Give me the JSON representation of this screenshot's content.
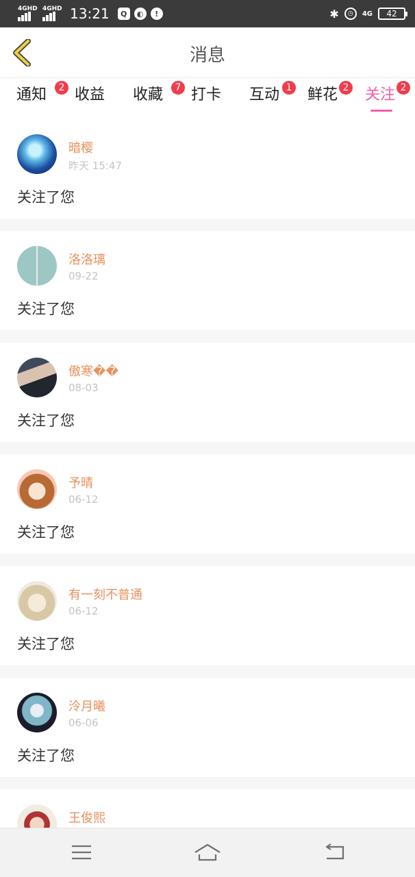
{
  "status_bar": {
    "net1": "4GHD",
    "net2": "4GHD",
    "time": "13:21",
    "net3": "4G",
    "battery": "42"
  },
  "header": {
    "title": "消息"
  },
  "tabs": [
    {
      "label": "通知",
      "badge": "2"
    },
    {
      "label": "收益",
      "badge": ""
    },
    {
      "label": "收藏",
      "badge": "7"
    },
    {
      "label": "打卡",
      "badge": ""
    },
    {
      "label": "互动",
      "badge": "1"
    },
    {
      "label": "鲜花",
      "badge": "2"
    },
    {
      "label": "关注",
      "badge": "2",
      "active": true
    }
  ],
  "feed": [
    {
      "name": "暗樱",
      "time": "昨天 15:47",
      "text": "关注了您"
    },
    {
      "name": "洛洛璃",
      "time": "09-22",
      "text": "关注了您"
    },
    {
      "name": "傲寒��",
      "time": "08-03",
      "text": "关注了您"
    },
    {
      "name": "予晴",
      "time": "06-12",
      "text": "关注了您"
    },
    {
      "name": "有一刻不普通",
      "time": "06-12",
      "text": "关注了您"
    },
    {
      "name": "泠月曦",
      "time": "06-06",
      "text": "关注了您"
    },
    {
      "name": "王俊熙",
      "time": "",
      "text": ""
    }
  ],
  "colors": {
    "accent": "#f060a8",
    "badge": "#f23c4c",
    "username": "#e8905c"
  },
  "icons": {
    "back": "chevron-left-icon",
    "menu": "menu-icon",
    "home": "home-icon",
    "return": "return-icon"
  }
}
